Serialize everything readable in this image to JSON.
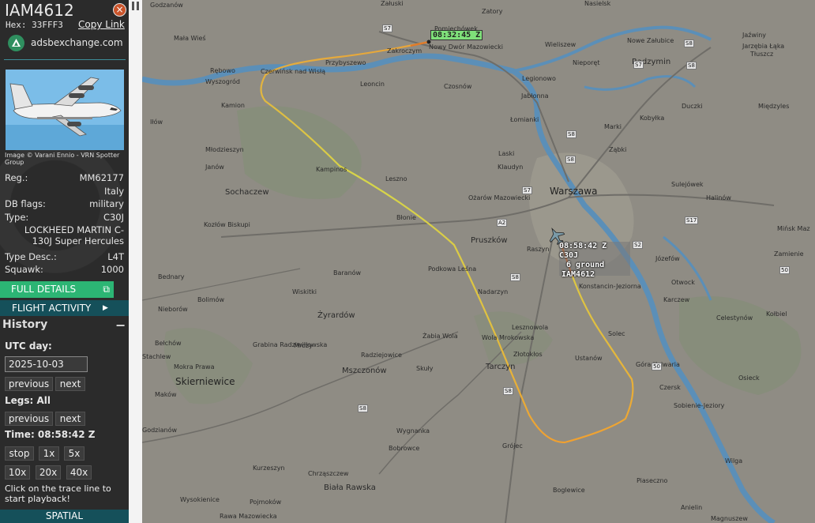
{
  "aircraft": {
    "callsign": "IAM4612",
    "hex_label": "Hex:",
    "hex": "33FFF3",
    "copy_link": "Copy Link",
    "source": "adsbexchange.com",
    "photo_credit": "Image © Varani Ennio - VRN Spotter Group",
    "reg_label": "Reg.:",
    "reg": "MM62177",
    "country": "Italy",
    "db_flags_label": "DB flags:",
    "db_flags": "military",
    "type_label": "Type:",
    "type": "C30J",
    "type_full": "LOCKHEED MARTIN C-130J Super Hercules",
    "type_desc_label": "Type Desc.:",
    "type_desc": "L4T",
    "squawk_label": "Squawk:",
    "squawk": "1000"
  },
  "buttons": {
    "full_details": "FULL DETAILS",
    "flight_activity": "FLIGHT ACTIVITY",
    "spatial": "SPATIAL"
  },
  "history": {
    "title": "History",
    "utc_day_label": "UTC day:",
    "date": "2025-10-03",
    "previous": "previous",
    "next": "next",
    "legs_label": "Legs: All",
    "time_label": "Time: 08:58:42 Z",
    "speed_buttons": [
      "stop",
      "1x",
      "5x",
      "10x",
      "20x",
      "40x"
    ],
    "hint": "Click on the trace line to start playback!"
  },
  "map": {
    "start_time": "08:32:45 Z",
    "ac_label_line1": "08:58:42 Z",
    "ac_label_line1b": "C30J",
    "ac_label_line2": "6 ground",
    "ac_label_line3": "IAM4612",
    "places": [
      {
        "id": "warszawa",
        "text": "Warszawa"
      },
      {
        "id": "legionowo",
        "text": "Legionowo"
      },
      {
        "id": "nowy-dwor",
        "text": "Nowy Dwór Mazowiecki"
      },
      {
        "id": "zakroczym",
        "text": "Zakroczym"
      },
      {
        "id": "pomiechowek",
        "text": "Pomiechówek"
      },
      {
        "id": "czerwinsk",
        "text": "Czerwińsk nad Wisłą"
      },
      {
        "id": "wyszogrod",
        "text": "Wyszogród"
      },
      {
        "id": "przybyszewo",
        "text": "Przybyszewo"
      },
      {
        "id": "leoncin",
        "text": "Leoncin"
      },
      {
        "id": "czosnow",
        "text": "Czosnów"
      },
      {
        "id": "lomianki",
        "text": "Łomianki"
      },
      {
        "id": "jablonna",
        "text": "Jabłonna"
      },
      {
        "id": "nieporet",
        "text": "Nieporęt"
      },
      {
        "id": "radzymin",
        "text": "Radzymin"
      },
      {
        "id": "wieliszew",
        "text": "Wieliszew"
      },
      {
        "id": "nowe-zalubice",
        "text": "Nowe Załubice"
      },
      {
        "id": "jadow",
        "text": "Jaźwiny"
      },
      {
        "id": "tluszcz",
        "text": "Tłuszcz"
      },
      {
        "id": "jarzebia",
        "text": "Jarzębia Łąka"
      },
      {
        "id": "marki",
        "text": "Marki"
      },
      {
        "id": "zabki",
        "text": "Ząbki"
      },
      {
        "id": "kobylka",
        "text": "Kobyłka"
      },
      {
        "id": "duczki",
        "text": "Duczki"
      },
      {
        "id": "miedzyles",
        "text": "Międzyles"
      },
      {
        "id": "sulejowek",
        "text": "Sulejówek"
      },
      {
        "id": "halinow",
        "text": "Halinów"
      },
      {
        "id": "minsk",
        "text": "Mińsk Maz"
      },
      {
        "id": "jozefow",
        "text": "Józefów"
      },
      {
        "id": "otwock",
        "text": "Otwock"
      },
      {
        "id": "karczew",
        "text": "Karczew"
      },
      {
        "id": "zamienie",
        "text": "Zamienie"
      },
      {
        "id": "celestynow",
        "text": "Celestynów"
      },
      {
        "id": "kolbiel",
        "text": "Kołbiel"
      },
      {
        "id": "konstancin",
        "text": "Konstancin-Jeziorna"
      },
      {
        "id": "raszyn",
        "text": "Raszyn"
      },
      {
        "id": "pruszkow",
        "text": "Pruszków"
      },
      {
        "id": "ozarow",
        "text": "Ożarów Mazowiecki"
      },
      {
        "id": "blonie",
        "text": "Błonie"
      },
      {
        "id": "leszno",
        "text": "Leszno"
      },
      {
        "id": "laski",
        "text": "Laski"
      },
      {
        "id": "kampinos",
        "text": "Kampinos"
      },
      {
        "id": "klaudyn",
        "text": "Klaudyn"
      },
      {
        "id": "sochaczew",
        "text": "Sochaczew"
      },
      {
        "id": "janow",
        "text": "Janów"
      },
      {
        "id": "mlodzieszyn",
        "text": "Młodzieszyn"
      },
      {
        "id": "kozlow",
        "text": "Kozłów Biskupi"
      },
      {
        "id": "ilow",
        "text": "Iłów"
      },
      {
        "id": "kamion",
        "text": "Kamion"
      },
      {
        "id": "rebowo",
        "text": "Rębowo"
      },
      {
        "id": "male-wies",
        "text": "Mała Wieś"
      },
      {
        "id": "podkowa",
        "text": "Podkowa Leśna"
      },
      {
        "id": "baranow",
        "text": "Baranów"
      },
      {
        "id": "nadarzyn",
        "text": "Nadarzyn"
      },
      {
        "id": "wiskitki",
        "text": "Wiskitki"
      },
      {
        "id": "bolimow",
        "text": "Bolimów"
      },
      {
        "id": "nieborow",
        "text": "Nieborów"
      },
      {
        "id": "zyrardow",
        "text": "Żyrardów"
      },
      {
        "id": "bednary",
        "text": "Bednary"
      },
      {
        "id": "zabia-wola",
        "text": "Żabia Wola"
      },
      {
        "id": "wola-mrokowska",
        "text": "Wola Mrokowska"
      },
      {
        "id": "lesznowola",
        "text": "Lesznowola"
      },
      {
        "id": "zlotokłos",
        "text": "Złotokłos"
      },
      {
        "id": "ustanow",
        "text": "Ustanów"
      },
      {
        "id": "solec",
        "text": "Solec"
      },
      {
        "id": "gora-kalwaria",
        "text": "Góra Kalwaria"
      },
      {
        "id": "czersk",
        "text": "Czersk"
      },
      {
        "id": "sobienie",
        "text": "Sobienie-Jeziory"
      },
      {
        "id": "osieck",
        "text": "Osieck"
      },
      {
        "id": "tarczyn",
        "text": "Tarczyn"
      },
      {
        "id": "grojec",
        "text": "Grójec"
      },
      {
        "id": "wygnanka",
        "text": "Wygnanka"
      },
      {
        "id": "bobrowce",
        "text": "Bobrowce"
      },
      {
        "id": "mszczonow",
        "text": "Mszczonów"
      },
      {
        "id": "radziejowice",
        "text": "Radziejowice"
      },
      {
        "id": "skuly",
        "text": "Skuły"
      },
      {
        "id": "mrozy",
        "text": "Mrozy"
      },
      {
        "id": "grabina",
        "text": "Grabina Radziwiłłowska"
      },
      {
        "id": "belchow",
        "text": "Bełchów"
      },
      {
        "id": "stachlew",
        "text": "Stachlew"
      },
      {
        "id": "mokra-prawa",
        "text": "Mokra Prawa"
      },
      {
        "id": "skierniewice",
        "text": "Skierniewice"
      },
      {
        "id": "makow",
        "text": "Maków"
      },
      {
        "id": "godzianow",
        "text": "Godzianów"
      },
      {
        "id": "kurzeszyn",
        "text": "Kurzeszyn"
      },
      {
        "id": "chrzaszczew",
        "text": "Chrząszczew"
      },
      {
        "id": "biala-rawska",
        "text": "Biała Rawska"
      },
      {
        "id": "wysokienice",
        "text": "Wysokienice"
      },
      {
        "id": "pojmokow",
        "text": "Pojmoków"
      },
      {
        "id": "rawa",
        "text": "Rawa Mazowiecka"
      },
      {
        "id": "boglewice",
        "text": "Boglewice"
      },
      {
        "id": "piaseczno2",
        "text": "Piaseczno"
      },
      {
        "id": "wilga",
        "text": "Wilga"
      },
      {
        "id": "anielin",
        "text": "Anielin"
      },
      {
        "id": "magnuszew",
        "text": "Magnuszew"
      },
      {
        "id": "zaluski",
        "text": "Załuski"
      },
      {
        "id": "nasielsk",
        "text": "Nasielsk"
      },
      {
        "id": "godzanow",
        "text": "Godzanów"
      },
      {
        "id": "zatory",
        "text": "Zatory"
      }
    ],
    "roads": [
      "S7",
      "S8",
      "A2",
      "S2",
      "S8",
      "S17",
      "50",
      "S8",
      "S7",
      "S8",
      "S8",
      "50",
      "S7",
      "S8",
      "S8"
    ],
    "track_color_start": "#e8a43a",
    "track_color_mid": "#d6d64a",
    "track_color_end": "#f0a030"
  }
}
